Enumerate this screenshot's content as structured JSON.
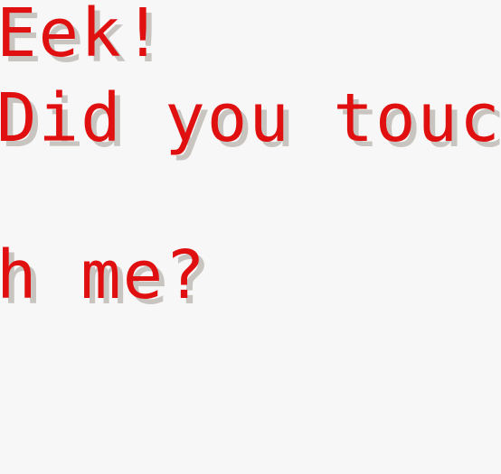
{
  "dialog": {
    "lines": [
      "Eek!",
      "Did you touc",
      "h me?"
    ]
  },
  "colors": {
    "background": "#f7f7f7",
    "text": "#e01010",
    "shadow": "#c8c4c0"
  }
}
